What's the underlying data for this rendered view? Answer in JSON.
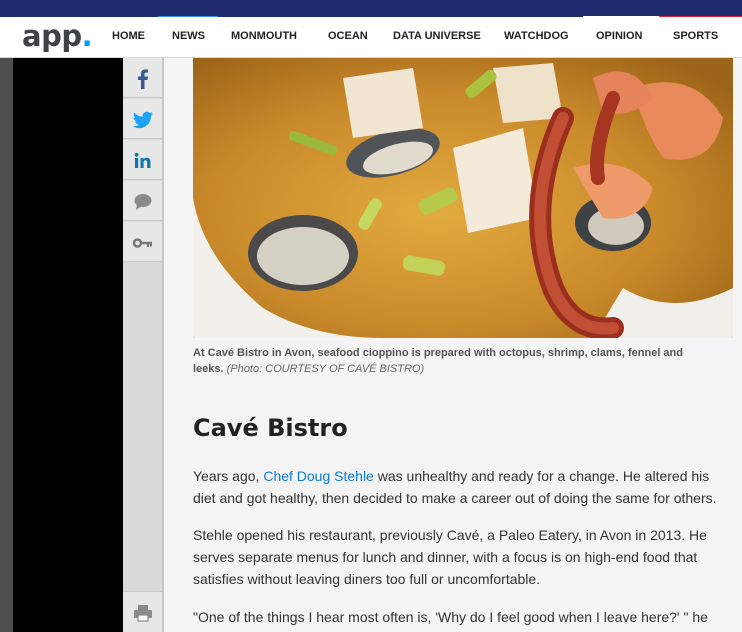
{
  "header": {
    "logo_text": "app",
    "logo_dot": ".",
    "nav": [
      "HOME",
      "NEWS",
      "MONMOUTH",
      "OCEAN",
      "DATA UNIVERSE",
      "WATCHDOG",
      "OPINION",
      "SPORTS"
    ]
  },
  "share_rail": {
    "buttons": [
      "facebook-icon",
      "twitter-icon",
      "linkedin-icon",
      "comment-icon",
      "key-icon"
    ],
    "print": "print-icon"
  },
  "article": {
    "caption_main": "At Cavé Bistro in Avon, seafood cioppino is prepared with octopus, shrimp, clams, fennel and leeks.",
    "caption_credit": "(Photo: COURTESY OF CAVÉ BISTRO)",
    "section_title": "Cavé Bistro",
    "p1_before": "Years ago, ",
    "p1_link": "Chef Doug Stehle",
    "p1_after": " was unhealthy and ready for a change. He altered his diet and got healthy, then decided to make a career out of doing the same for others.",
    "p2": "Stehle opened his restaurant, previously Cavé, a Paleo Eatery, in Avon in 2013. He serves separate menus for lunch and dinner, with a focus is on high-end food that satisfies without leaving diners too full or uncomfortable.",
    "p3": "\"One of the things I hear most often is, 'Why do I feel good when I leave here?' \" he"
  },
  "colors": {
    "topbar": "#1e2b6e",
    "link": "#0a7ad4",
    "logo_dot": "#009bff"
  }
}
